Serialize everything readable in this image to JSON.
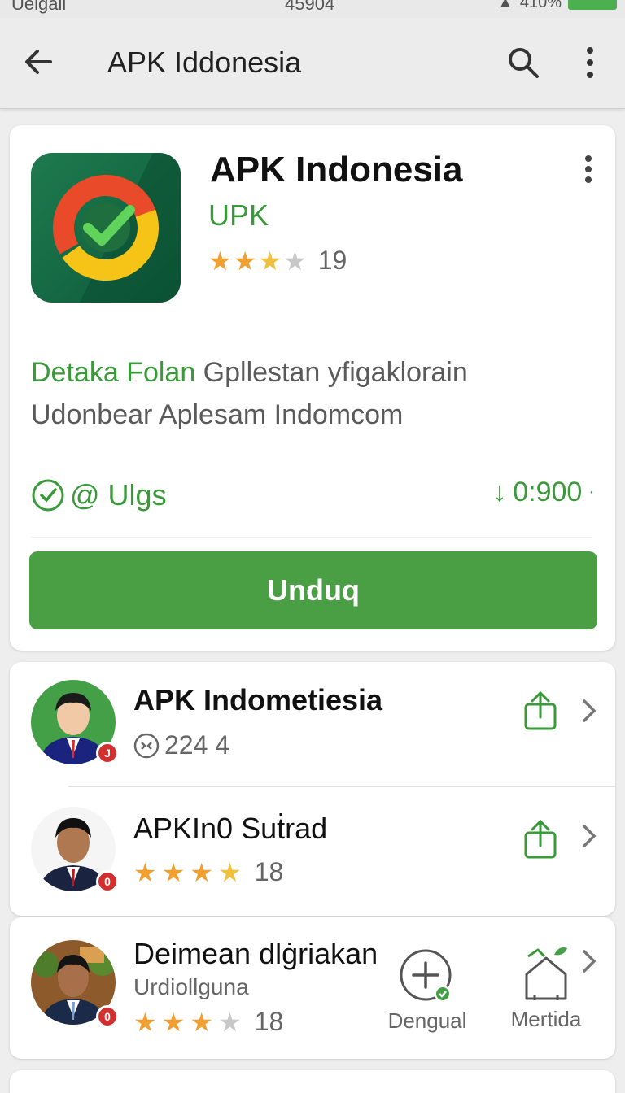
{
  "status_bar": {
    "carrier": "Uelgall",
    "time": "45904",
    "battery": "410%"
  },
  "toolbar": {
    "title": "APK Iddonesia"
  },
  "app": {
    "name": "APK Indonesia",
    "developer": "UPK",
    "rating": 3.5,
    "rating_count": "19",
    "description_accent": "Detaka Folan",
    "description_rest": " Gpllestan yfigaklorain",
    "description_line2": "Udonbear Aplesam Indomcom",
    "meta_left": "@ Ulgs",
    "meta_right": "0:900",
    "install_label": "Unduq"
  },
  "list": [
    {
      "title": "APK Indometiesia",
      "sub": "224 4",
      "rating": null
    },
    {
      "title": "APKIn0 Suṫrad",
      "sub": "18",
      "rating": 4.5
    },
    {
      "title": "Deimean dlġriakan",
      "subtitle": "Urdiollguna",
      "sub": "18",
      "rating": 3,
      "action1_label": "Dengual",
      "action2_label": "Mertida"
    }
  ],
  "colors": {
    "accent": "#4a9e44",
    "star": "#f0a030"
  }
}
